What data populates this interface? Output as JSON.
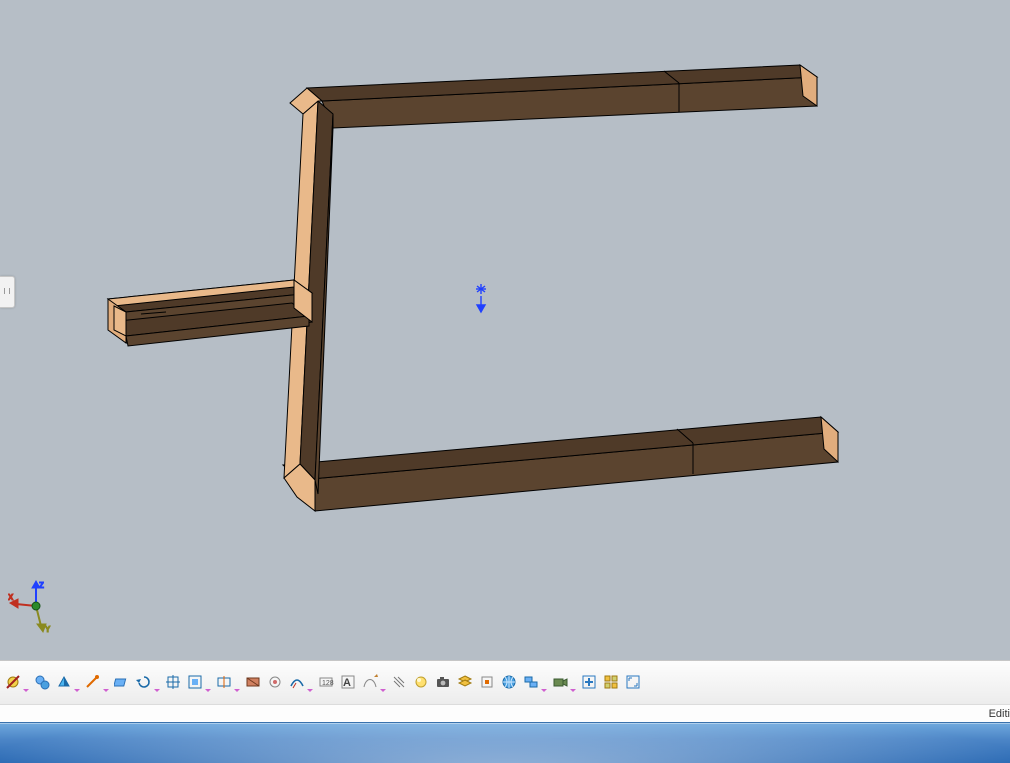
{
  "status_text": "Editi",
  "axis_labels": {
    "x": "X",
    "y": "Y",
    "z": "Z"
  },
  "toolbar": {
    "items": [
      {
        "name": "hide-show-icon",
        "title": "Hide/Show",
        "dd": true
      },
      {
        "name": "swap-visible-icon",
        "title": "Swap visible space",
        "dd": false
      },
      {
        "name": "shading-icon",
        "title": "Shading mode",
        "dd": true
      },
      {
        "name": "edge-icon",
        "title": "Apply material",
        "dd": true
      },
      {
        "name": "plane-icon",
        "title": "Work plane",
        "dd": false
      },
      {
        "name": "rotate-icon",
        "title": "Rotate view",
        "dd": true
      },
      {
        "name": "pan-icon",
        "title": "Pan",
        "dd": false
      },
      {
        "name": "fit-icon",
        "title": "Fit all",
        "dd": true
      },
      {
        "name": "normal-view-icon",
        "title": "Normal view",
        "dd": true
      },
      {
        "name": "section-icon",
        "title": "Sectioning",
        "dd": false
      },
      {
        "name": "clip-icon",
        "title": "Clipping",
        "dd": false
      },
      {
        "name": "curve-icon",
        "title": "Curve display",
        "dd": true
      },
      {
        "name": "dimensions-icon",
        "title": "Dimensions",
        "dd": false
      },
      {
        "name": "text-ann-icon",
        "title": "Annotations",
        "dd": false
      },
      {
        "name": "sketch-icon",
        "title": "Sketch tools",
        "dd": true
      },
      {
        "name": "thread-icon",
        "title": "Thread display",
        "dd": false
      },
      {
        "name": "render-icon",
        "title": "Render style",
        "dd": false
      },
      {
        "name": "capture-icon",
        "title": "Capture",
        "dd": false
      },
      {
        "name": "layers-icon",
        "title": "Layers",
        "dd": false
      },
      {
        "name": "isolate-icon",
        "title": "Isolate",
        "dd": false
      },
      {
        "name": "globe-icon",
        "title": "Global view",
        "dd": false
      },
      {
        "name": "named-views-icon",
        "title": "Named views",
        "dd": true
      },
      {
        "name": "camera-icon",
        "title": "Camera",
        "dd": true
      },
      {
        "name": "create-view-icon",
        "title": "Create view",
        "dd": false
      },
      {
        "name": "multi-view-icon",
        "title": "Multi-view",
        "dd": false
      },
      {
        "name": "full-screen-icon",
        "title": "Full screen",
        "dd": false
      }
    ]
  }
}
